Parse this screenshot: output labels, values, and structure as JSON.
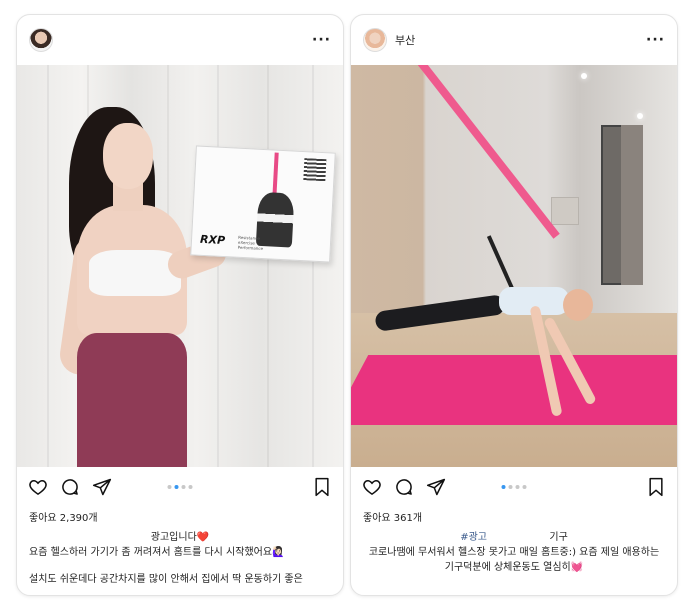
{
  "posts": [
    {
      "username": "",
      "more_icon": "more-horizontal-icon",
      "likes": "좋아요 2,390개",
      "caption": {
        "line1": "광고입니다❤️",
        "line2": "요즘 헬스하러 가기가 좀 꺼려져서 홈트를 다시 시작했어요🙋🏻‍♀️",
        "line3": "설치도 쉬운데다 공간차지를 많이 안해서 집에서 딱 운동하기 좋은"
      },
      "product_box": {
        "logo": "RXP",
        "subtitle": "Resistance eXercise Performance"
      },
      "carousel": {
        "count": 4,
        "active": 1
      }
    },
    {
      "username": "부산",
      "more_icon": "more-horizontal-icon",
      "likes": "좋아요 361개",
      "caption": {
        "hashtag": "#광고",
        "line1_rest": "기구",
        "line2": "코로나땜에 무서워서 헬스장 못가고 매일 홈트중:) 요즘 제일 애용하는",
        "line3": "기구덕분에 상체운동도 열심히💓"
      },
      "carousel": {
        "count": 4,
        "active": 0
      }
    }
  ],
  "icons": {
    "like": "heart-icon",
    "comment": "comment-icon",
    "share": "send-icon",
    "save": "bookmark-icon"
  },
  "colors": {
    "carousel_active": "#3897f0",
    "hashtag": "#3b5b8c",
    "mat": "#e9337f",
    "strap": "#ef5a8e",
    "leggings": "#8f3b56"
  }
}
